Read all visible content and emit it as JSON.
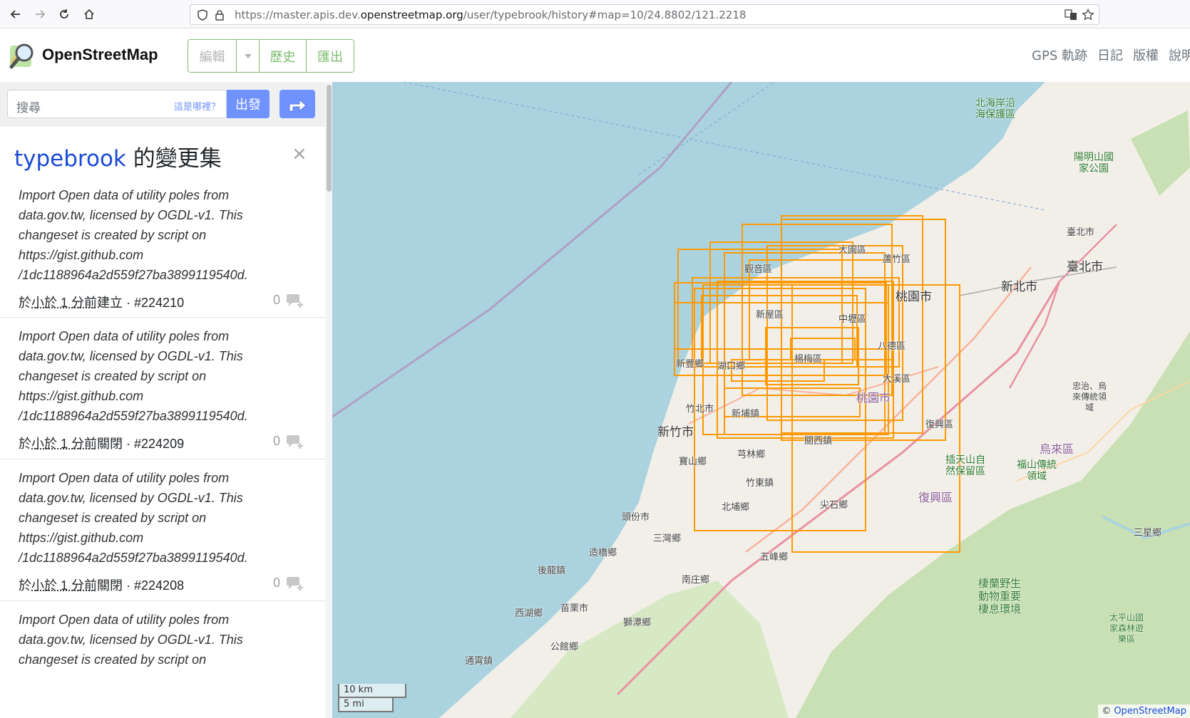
{
  "browser": {
    "url_prefix": "https://master.apis.dev.",
    "url_host": "openstreetmap.org",
    "url_suffix": "/user/typebrook/history#map=10/24.8802/121.2218"
  },
  "header": {
    "brand": "OpenStreetMap",
    "edit_label": "編輯",
    "history_label": "歷史",
    "export_label": "匯出",
    "links": [
      "GPS 軌跡",
      "日記",
      "版權",
      "說明"
    ]
  },
  "search": {
    "placeholder": "搜尋",
    "where_link": "這是哪裡？",
    "go_label": "出發"
  },
  "panel": {
    "username": "typebrook",
    "title_suffix": " 的變更集",
    "close": "×"
  },
  "changesets": [
    {
      "comment": "Import Open data of utility poles from\ndata.gov.tw, licensed by OGDL-v1. This\nchangeset is created by script on\nhttps://gist.github.com\n/1dc1188964a2d559f27ba3899119540d.",
      "prefix": "於",
      "time": "小於 1 分前",
      "action": "建立",
      "id": " · #224210",
      "comments": "0"
    },
    {
      "comment": "Import Open data of utility poles from\ndata.gov.tw, licensed by OGDL-v1. This\nchangeset is created by script on\nhttps://gist.github.com\n/1dc1188964a2d559f27ba3899119540d.",
      "prefix": "於",
      "time": "小於 1 分前",
      "action": "關閉",
      "id": " · #224209",
      "comments": "0"
    },
    {
      "comment": "Import Open data of utility poles from\ndata.gov.tw, licensed by OGDL-v1. This\nchangeset is created by script on\nhttps://gist.github.com\n/1dc1188964a2d559f27ba3899119540d.",
      "prefix": "於",
      "time": "小於 1 分前",
      "action": "關閉",
      "id": " · #224208",
      "comments": "0"
    },
    {
      "comment": "Import Open data of utility poles from\ndata.gov.tw, licensed by OGDL-v1. This\nchangeset is created by script on",
      "prefix": "",
      "time": "",
      "action": "",
      "id": "",
      "comments": ""
    }
  ],
  "map": {
    "labels": {
      "beihai": "北海岸沿\n海保護區",
      "yangming": "陽明山國\n家公園",
      "taipei1": "臺北市",
      "taipei2": "臺北市",
      "newtaipei": "新北市",
      "taoyuan_dist": "桃園市",
      "taoyuan_city": "桃園市",
      "dayuan": "大園區",
      "luzhu": "蘆竹區",
      "guanyin": "觀音區",
      "xinwu": "新屋區",
      "zhongli": "中壢區",
      "bade": "八德區",
      "yangmei": "楊梅區",
      "xinfeng": "新豐鄉",
      "hukou": "湖口鄉",
      "daxi": "大溪區",
      "zhubei": "竹北市",
      "xinpu": "新埔鎮",
      "hsinchu": "新竹市",
      "fuxing1": "復興區",
      "guanxi": "關西鎮",
      "qionglin": "芎林鄉",
      "baoshan": "寶山鄉",
      "zhudong": "竹東鎮",
      "beipu": "北埔鄉",
      "jianshi": "尖石鄉",
      "toufen": "頭份市",
      "sanwan": "三灣鄉",
      "zaoqiao": "造橋鄉",
      "wufeng": "五峰鄉",
      "houlong": "後龍鎮",
      "nanzhuang": "南庄鄉",
      "xihu": "西湖鄉",
      "miaoli": "苗栗市",
      "shitan": "獅潭鄉",
      "gongguan": "公館鄉",
      "tongxiao": "通霄鎮",
      "wulai": "烏來區",
      "fushan": "福山傳統\n領域",
      "fuxing2": "復興區",
      "lalashan": "插天山自\n然保留區",
      "sanxia": "三星鄉",
      "qilan": "棲蘭野生\n動物重要\n棲息環境",
      "taipingshan": "太平山國\n家森林遊\n樂區",
      "zhongzhi": "忠治、烏\n來傳統領\n域"
    },
    "scale_km": "10 km",
    "scale_mi": "5 mi",
    "attribution_prefix": "© ",
    "attribution_link": "OpenStreetMap"
  },
  "colors": {
    "accent": "#7ebc6f",
    "button": "#7092ff",
    "bbox": "#ff9900",
    "sea": "#aad3df"
  }
}
